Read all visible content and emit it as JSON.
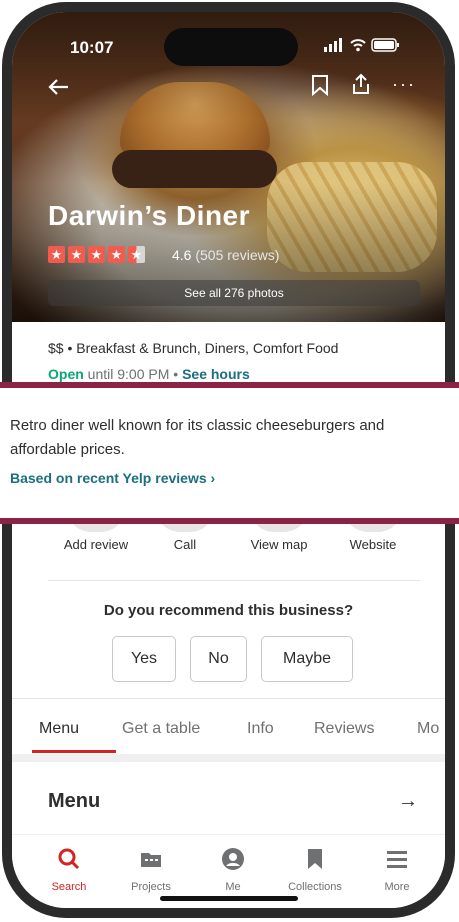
{
  "status_bar": {
    "time": "10:07",
    "icons": "▂▄▆ ◉ ▭"
  },
  "top_bar": {
    "back": "←",
    "bookmark": "🔖",
    "share": "⇪",
    "more": "···"
  },
  "business": {
    "name": "Darwin’s Diner",
    "rating_value": "4.6",
    "reviews": "(505 reviews)",
    "stars": 4.5,
    "photos_button": "See all 276 photos",
    "price_categories": "$$ • Breakfast & Brunch, Diners, Comfort Food",
    "open_status": "Open",
    "hours_text": "until 9:00 PM •",
    "see_hours": "See hours"
  },
  "summary": {
    "text": "Retro diner well known for its classic cheeseburgers and affordable prices.",
    "link": "Based on recent Yelp reviews ›"
  },
  "actions": [
    {
      "label": "Add review"
    },
    {
      "label": "Call"
    },
    {
      "label": "View map"
    },
    {
      "label": "Website"
    }
  ],
  "recommend": {
    "question": "Do you recommend this business?",
    "options": [
      "Yes",
      "No",
      "Maybe"
    ]
  },
  "tabs": [
    "Menu",
    "Get a table",
    "Info",
    "Reviews",
    "Mo"
  ],
  "active_tab": "Menu",
  "menu_section": {
    "title": "Menu",
    "arrow": "→"
  },
  "bottom_nav": [
    {
      "label": "Search",
      "icon": "search-icon"
    },
    {
      "label": "Projects",
      "icon": "projects-icon"
    },
    {
      "label": "Me",
      "icon": "profile-icon"
    },
    {
      "label": "Collections",
      "icon": "bookmark-icon"
    },
    {
      "label": "More",
      "icon": "menu-icon"
    }
  ],
  "colors": {
    "brand_red": "#d32323",
    "band": "#8b2346",
    "link_teal": "#1b6f7f",
    "open_green": "#0aa679",
    "star": "#f15c4f"
  }
}
